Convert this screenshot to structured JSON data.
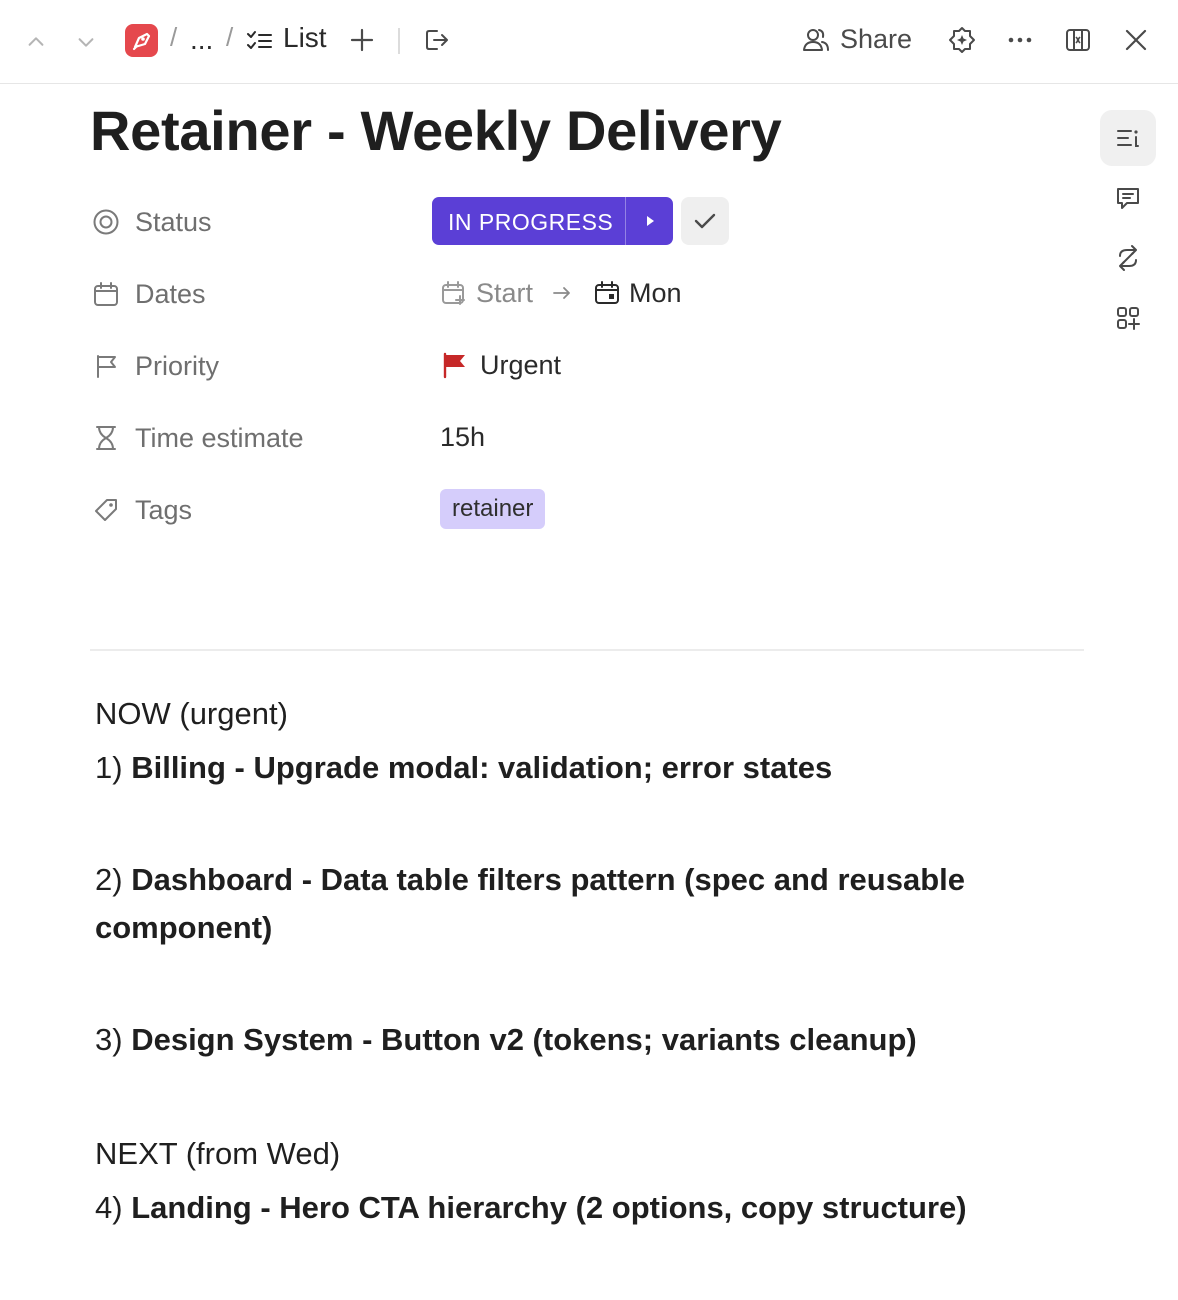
{
  "topbar": {
    "breadcrumb_ellipsis": "...",
    "breadcrumb_separator": "/",
    "list_label": "List",
    "share_label": "Share"
  },
  "title": "Retainer - Weekly Delivery",
  "properties": {
    "status": {
      "label": "Status",
      "value": "IN PROGRESS",
      "color": "#5b3fd6"
    },
    "dates": {
      "label": "Dates",
      "start": "Start",
      "end": "Mon"
    },
    "priority": {
      "label": "Priority",
      "value": "Urgent",
      "flag_color": "#c62828"
    },
    "time_estimate": {
      "label": "Time estimate",
      "value": "15h"
    },
    "tags": {
      "label": "Tags",
      "items": [
        {
          "label": "retainer",
          "color": "#d5cdfb"
        }
      ]
    }
  },
  "description": {
    "now_heading": "NOW (urgent)",
    "next_heading": "NEXT (from Wed)",
    "items": [
      {
        "num": "1)",
        "text": "Billing - Upgrade modal: validation; error states"
      },
      {
        "num": "2)",
        "text": "Dashboard - Data table filters pattern (spec and reusable component)"
      },
      {
        "num": "3)",
        "text": "Design System - Button v2 (tokens; variants cleanup)"
      },
      {
        "num": "4)",
        "text": "Landing - Hero CTA hierarchy (2 options, copy structure)"
      }
    ]
  },
  "icons": {
    "nav_up": "chevron-up-icon",
    "nav_down": "chevron-down-icon",
    "add": "plus-icon",
    "move": "move-out-icon",
    "share": "users-icon",
    "ai": "sparkle-gear-icon",
    "more": "more-icon",
    "expand": "expand-icon",
    "close": "close-icon"
  }
}
